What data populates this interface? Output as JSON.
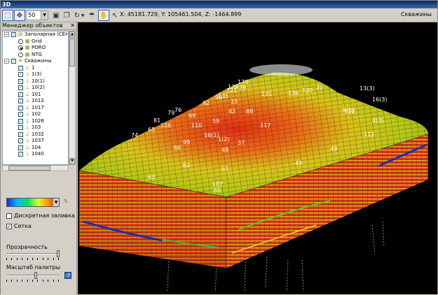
{
  "window": {
    "title": "3D"
  },
  "toolbar": {
    "zoom_value": "50",
    "coords": "X: 45181.729, Y: 105461.504, Z: -1464.899",
    "mode": "Скважины"
  },
  "left_panel": {
    "title": "Менеджер объектов",
    "tree": [
      {
        "label": "Заполярная (СЕНО",
        "expander": "minus",
        "checked": true,
        "icon": "folder-icon",
        "level": 0
      },
      {
        "label": "Grid",
        "radio": false,
        "icon": "grid-icon",
        "level": 1
      },
      {
        "label": "PORO",
        "radio": true,
        "icon": "grid-icon",
        "level": 1
      },
      {
        "label": "NTG",
        "radio": false,
        "icon": "grid-icon",
        "level": 1
      },
      {
        "label": "Скважины",
        "expander": "minus",
        "checked": true,
        "icon": "wells-icon",
        "level": 0
      },
      {
        "label": "1",
        "checked": true,
        "icon": "well-icon",
        "level": 1
      },
      {
        "label": "1(3)",
        "checked": true,
        "icon": "well-icon",
        "level": 1
      },
      {
        "label": "10(1)",
        "checked": true,
        "icon": "well-icon",
        "level": 1
      },
      {
        "label": "10(2)",
        "checked": true,
        "icon": "well-icon",
        "level": 1
      },
      {
        "label": "101",
        "checked": true,
        "icon": "well-icon",
        "level": 1
      },
      {
        "label": "1012",
        "checked": true,
        "icon": "well-icon",
        "level": 1
      },
      {
        "label": "1017",
        "checked": true,
        "icon": "well-icon",
        "level": 1
      },
      {
        "label": "102",
        "checked": true,
        "icon": "well-icon",
        "level": 1
      },
      {
        "label": "1026",
        "checked": true,
        "icon": "well-icon",
        "level": 1
      },
      {
        "label": "103",
        "checked": true,
        "icon": "well-icon",
        "level": 1
      },
      {
        "label": "1032",
        "checked": true,
        "icon": "well-icon",
        "level": 1
      },
      {
        "label": "1037",
        "checked": true,
        "icon": "well-icon",
        "level": 1
      },
      {
        "label": "104",
        "checked": true,
        "icon": "well-icon",
        "level": 1
      },
      {
        "label": "1040",
        "checked": true,
        "icon": "well-icon",
        "level": 1
      }
    ],
    "discrete_fill": {
      "label": "Дискретная заливка",
      "checked": false
    },
    "grid_lines": {
      "label": "Сетка",
      "checked": true
    },
    "transparency": {
      "label": "Прозрачность",
      "value": 1.0
    },
    "palette_scale": {
      "label": "Масштаб палитры",
      "value": 0.55
    }
  },
  "view": {
    "well_labels": [
      "79",
      "76",
      "65",
      "81",
      "116",
      "66",
      "74",
      "69",
      "82",
      "90",
      "110",
      "99",
      "135",
      "121",
      "28",
      "15",
      "16(1)",
      "1(2)",
      "48",
      "59",
      "42",
      "49",
      "43",
      "13(3)",
      "16(3)",
      "110",
      "9(2)",
      "4(3)",
      "113",
      "63",
      "62",
      "51",
      "107",
      "60",
      "37",
      "176",
      "170",
      "120",
      "126",
      "131",
      "88",
      "117",
      "22"
    ]
  },
  "colors": {
    "titlebar": "#0a246a",
    "panel": "#d4d0c8",
    "viewport": "#000000"
  }
}
